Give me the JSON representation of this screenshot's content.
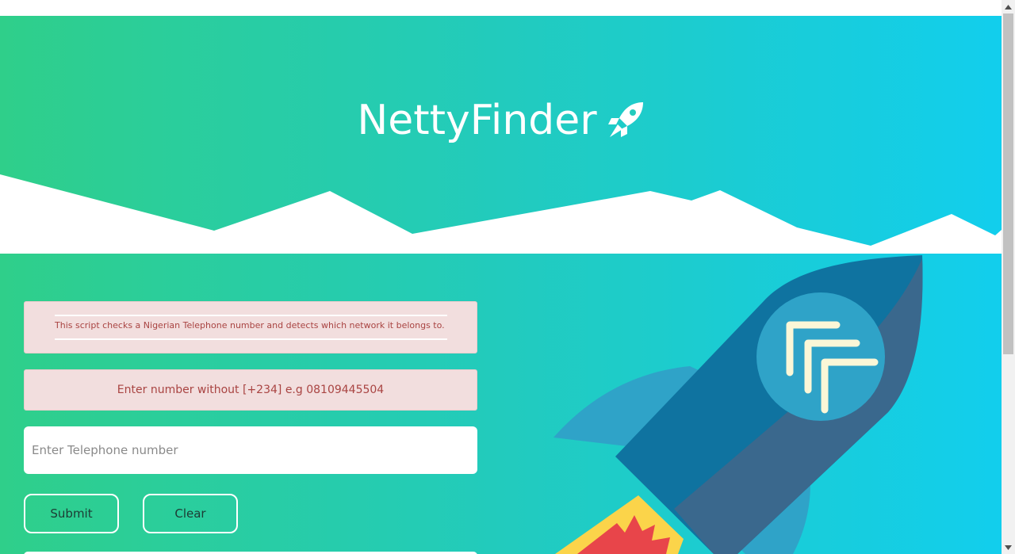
{
  "app": {
    "title": "NettyFinder"
  },
  "hero": {
    "title": "NettyFinder",
    "icon": "rocket-icon"
  },
  "form": {
    "info_text": "This script checks a Nigerian Telephone number and detects which network it belongs to.",
    "hint_text": "Enter number without [+234] e.g 08109445504",
    "phone_placeholder": "Enter Telephone number",
    "phone_value": "",
    "submit_label": "Submit",
    "clear_label": "Clear"
  },
  "colors": {
    "gradient_start": "#2fcf8a",
    "gradient_end": "#12ceed",
    "alert_bg": "#f2dede",
    "alert_text": "#a94442",
    "rocket_body": "#0f73a0",
    "rocket_fin": "#2fa3c8",
    "flame_yellow": "#fbd44a",
    "flame_red": "#e8454a"
  }
}
